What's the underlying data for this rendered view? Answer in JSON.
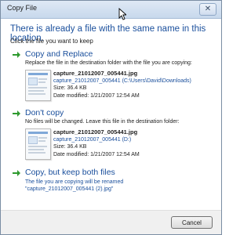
{
  "window": {
    "title": "Copy File",
    "close_glyph": "✕"
  },
  "dialog": {
    "heading": "There is already a file with the same name in this location.",
    "subheading": "Click the file you want to keep"
  },
  "options": {
    "copy_replace": {
      "title": "Copy and Replace",
      "description": "Replace the file in the destination folder with the file you are copying:",
      "icon": "green-arrow-icon",
      "file": {
        "name": "capture_21012007_005441.jpg",
        "path": "capture_21012007_005441 (C:\\Users\\David\\Downloads)",
        "size": "Size: 36.4 KB",
        "modified": "Date modified: 1/21/2007 12:54 AM"
      }
    },
    "dont_copy": {
      "title": "Don't copy",
      "description": "No files will be changed. Leave this file in the destination folder:",
      "icon": "green-arrow-icon",
      "file": {
        "name": "capture_21012007_005441.jpg",
        "path": "capture_21012007_005441 (D:)",
        "size": "Size: 36.4 KB",
        "modified": "Date modified: 1/21/2007 12:54 AM"
      }
    },
    "keep_both": {
      "title": "Copy, but keep both files",
      "description": "The file you are copying will be renamed \"capture_21012007_005441 (2).jpg\"",
      "icon": "green-arrow-icon"
    }
  },
  "footer": {
    "cancel_label": "Cancel"
  },
  "colors": {
    "accent": "#1a4f9c",
    "arrow": "#2e9a2e"
  }
}
